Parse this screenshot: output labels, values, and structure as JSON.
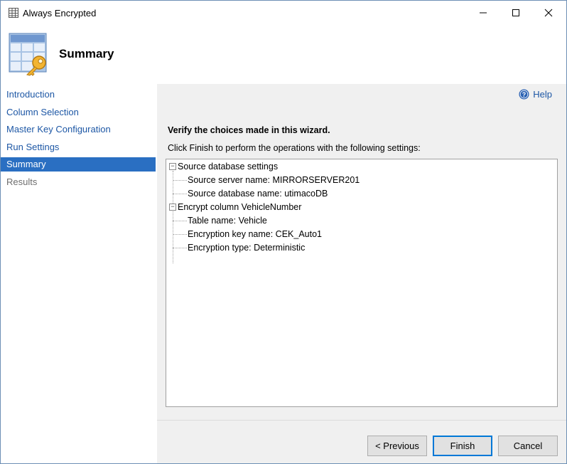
{
  "window": {
    "title": "Always Encrypted"
  },
  "header": {
    "heading": "Summary"
  },
  "sidebar": {
    "items": [
      {
        "label": "Introduction",
        "state": "link"
      },
      {
        "label": "Column Selection",
        "state": "link"
      },
      {
        "label": "Master Key Configuration",
        "state": "link"
      },
      {
        "label": "Run Settings",
        "state": "link"
      },
      {
        "label": "Summary",
        "state": "active"
      },
      {
        "label": "Results",
        "state": "disabled"
      }
    ]
  },
  "main": {
    "help_label": "Help",
    "verify_text": "Verify the choices made in this wizard.",
    "instruction_text": "Click Finish to perform the operations with the following settings:",
    "tree": {
      "groups": [
        {
          "label": "Source database settings",
          "children": [
            "Source server name: MIRRORSERVER201",
            "Source database name: utimacoDB"
          ]
        },
        {
          "label": "Encrypt column VehicleNumber",
          "children": [
            "Table name: Vehicle",
            "Encryption key name: CEK_Auto1",
            "Encryption type: Deterministic"
          ]
        }
      ]
    }
  },
  "buttons": {
    "previous": "< Previous",
    "finish": "Finish",
    "cancel": "Cancel"
  },
  "colors": {
    "link": "#1d57a5",
    "active_bg": "#2a6fc2",
    "panel_bg": "#f0f0f0",
    "default_button_border": "#0078d7"
  }
}
